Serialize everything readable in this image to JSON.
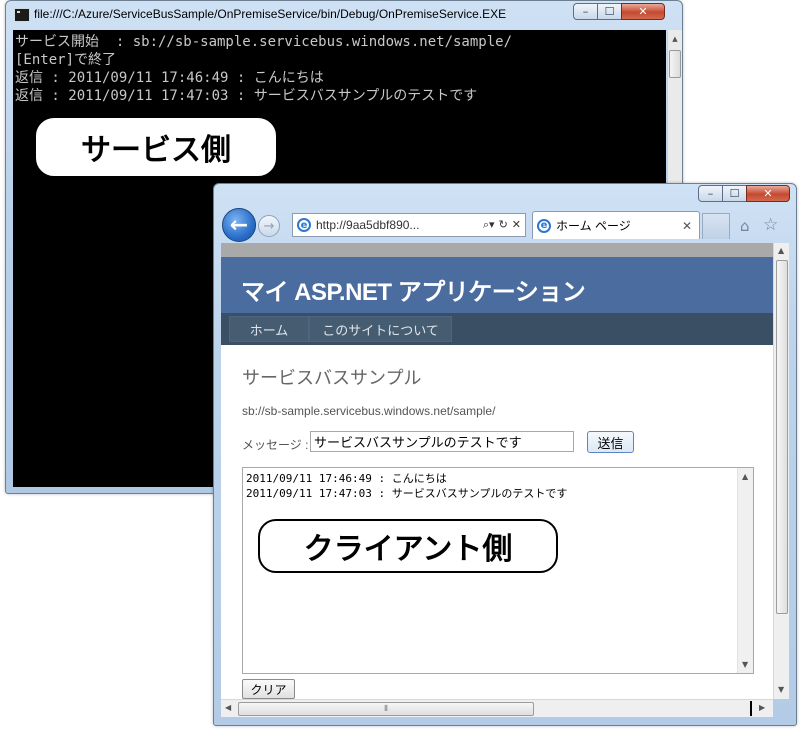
{
  "console": {
    "title": "file:///C:/Azure/ServiceBusSample/OnPremiseService/bin/Debug/OnPremiseService.EXE",
    "lines": [
      "サービス開始  : sb://sb-sample.servicebus.windows.net/sample/",
      "[Enter]で終了",
      "返信 : 2011/09/11 17:46:49 : こんにちは",
      "返信 : 2011/09/11 17:47:03 : サービスバスサンプルのテストです"
    ],
    "callout": "サービス側",
    "buttons": {
      "minimize": "–",
      "maximize": "☐",
      "close": "✕"
    }
  },
  "browser": {
    "address": "http://9aa5dbf890...",
    "tab_title": "ホーム ページ",
    "site_title": "マイ ASP.NET アプリケーション",
    "menu": {
      "home": "ホーム",
      "about": "このサイトについて"
    },
    "page_heading": "サービスバスサンプル",
    "service_url": "sb://sb-sample.servicebus.windows.net/sample/",
    "message_label": "メッセージ :",
    "message_value": "サービスバスサンプルのテストです",
    "send_label": "送信",
    "log_lines": [
      "2011/09/11 17:46:49 : こんにちは",
      "2011/09/11 17:47:03 : サービスバスサンプルのテストです"
    ],
    "clear_label": "クリア",
    "callout": "クライアント側",
    "buttons": {
      "minimize": "–",
      "maximize": "☐",
      "close": "✕"
    }
  },
  "icons": [
    "app-icon",
    "back-icon",
    "forward-icon",
    "ie-icon",
    "search-icon",
    "refresh-icon",
    "stop-icon",
    "home-icon",
    "favorites-icon"
  ]
}
